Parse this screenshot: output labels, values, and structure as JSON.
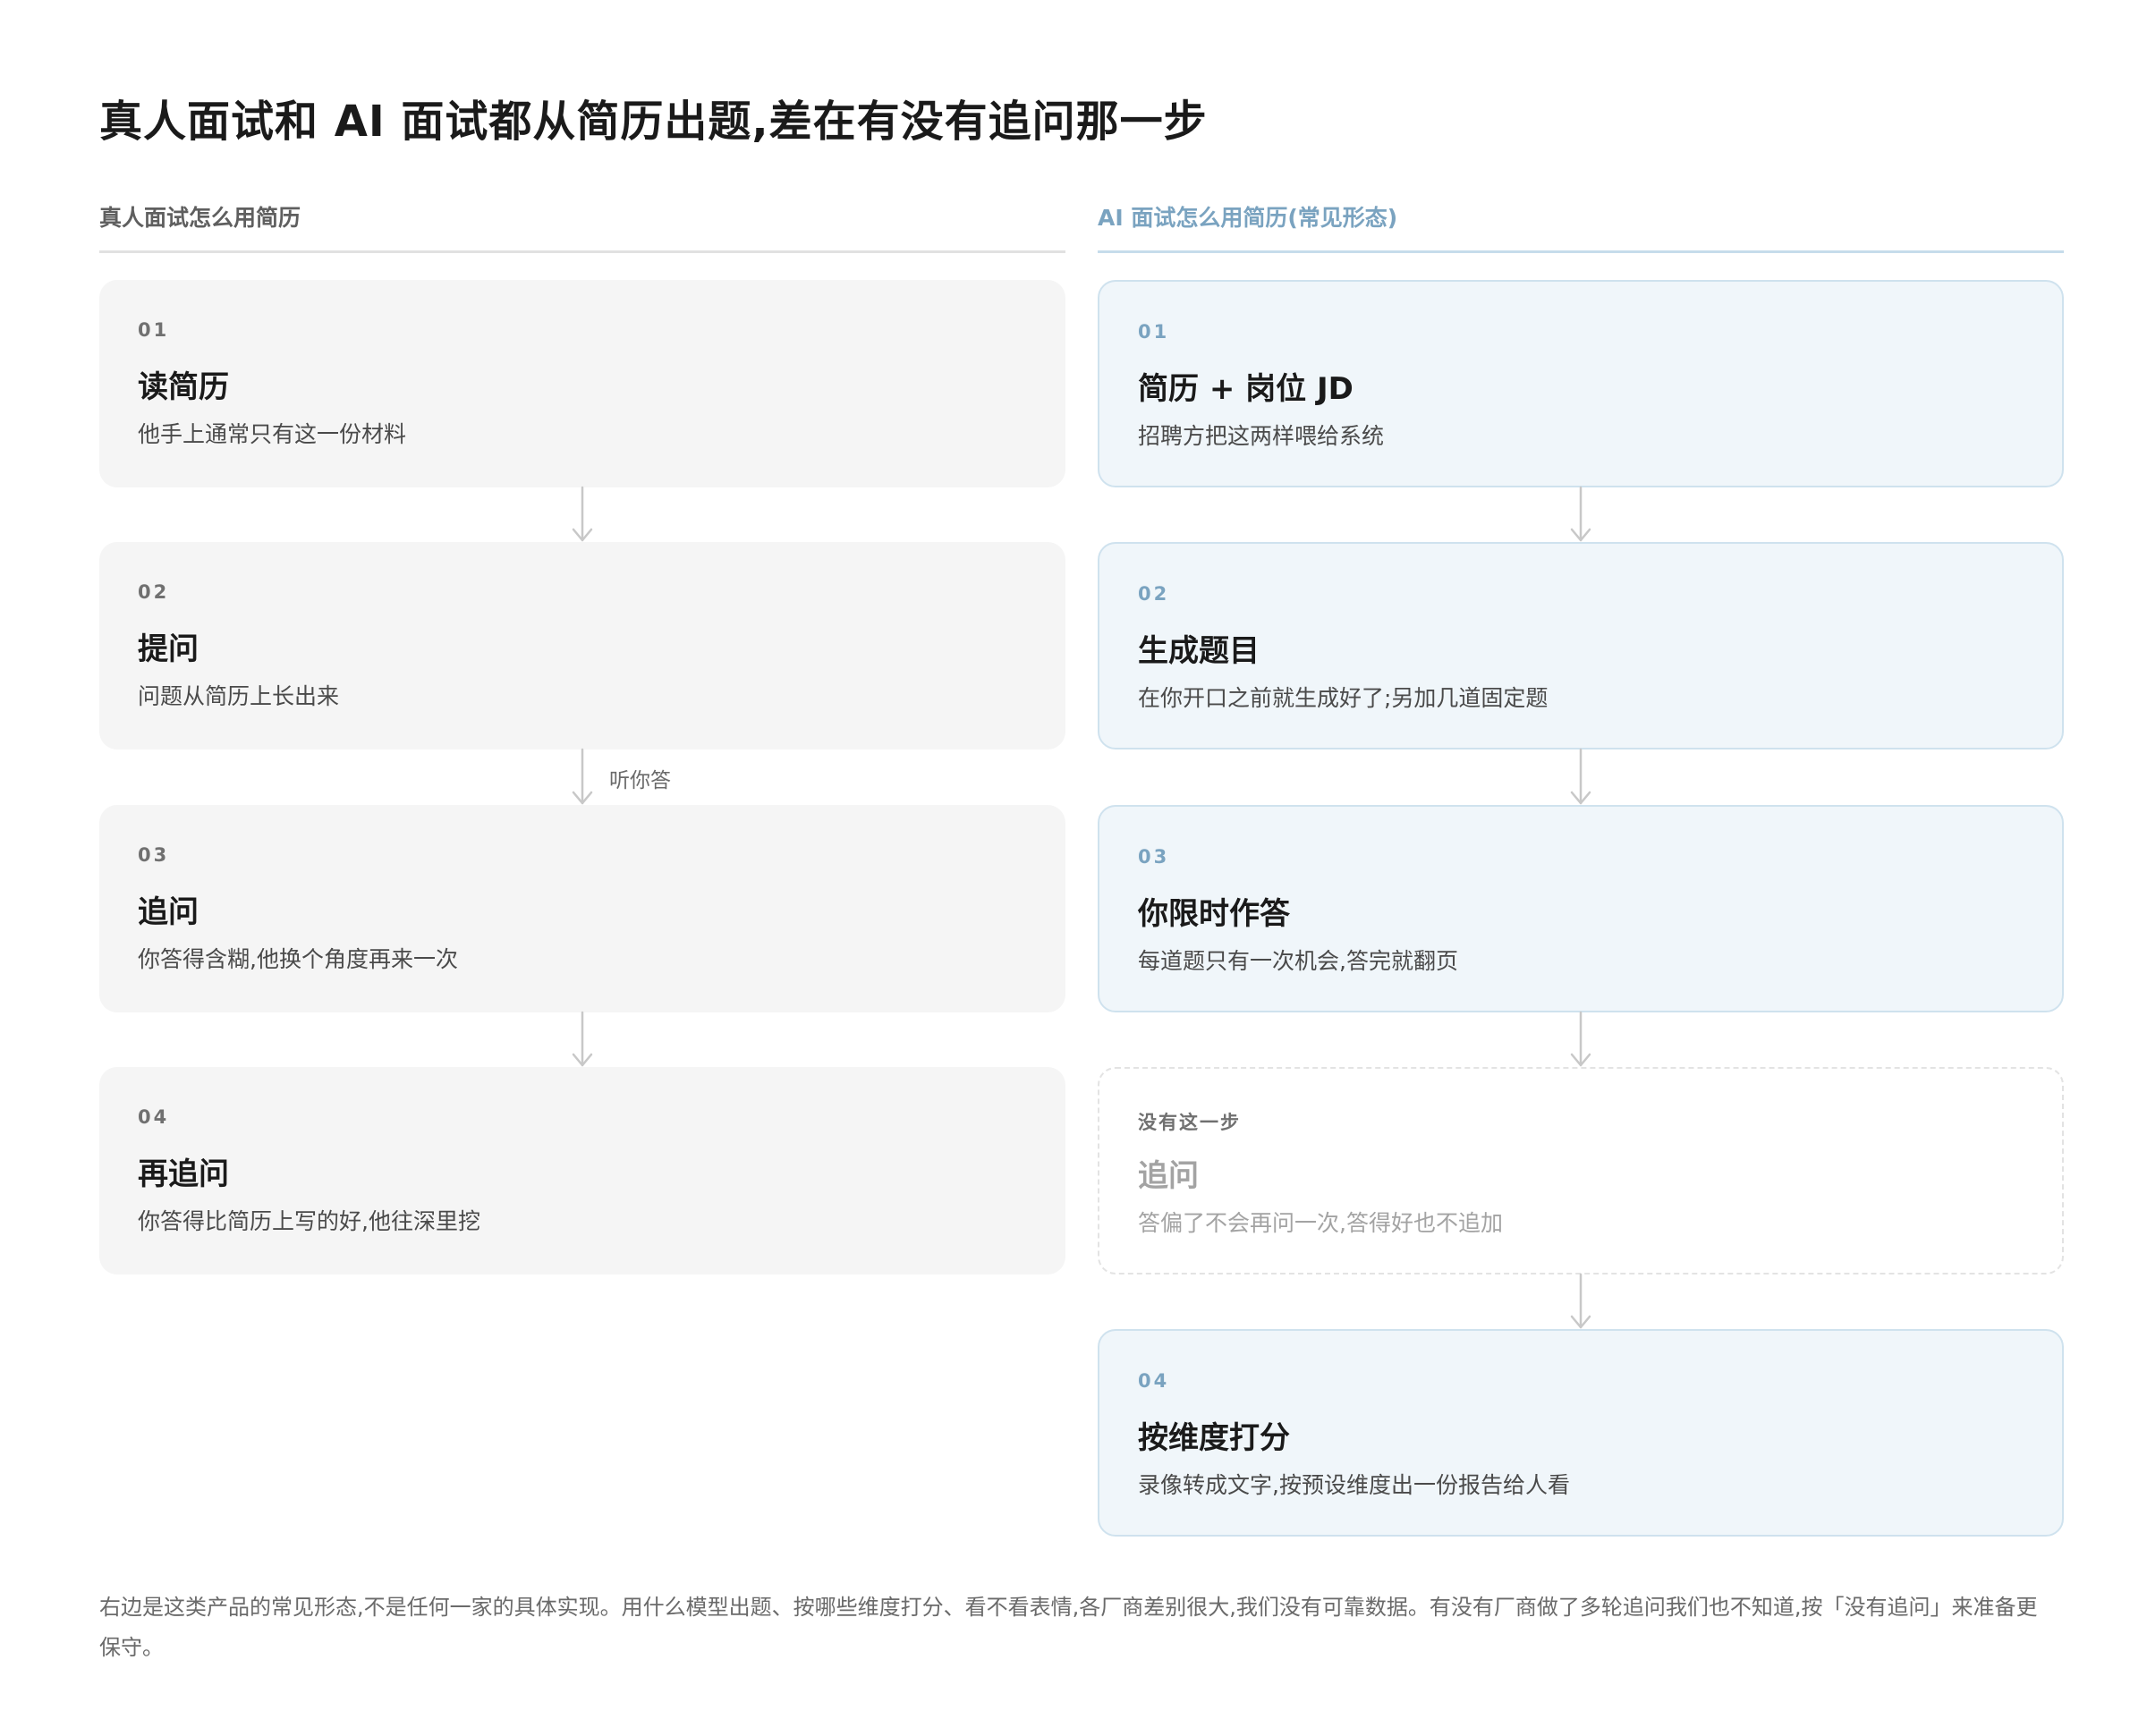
{
  "title": "真人面试和 AI 面试都从简历出题,差在有没有追问那一步",
  "human": {
    "heading": "真人面试怎么用简历",
    "arrow_label": "听你答",
    "steps": [
      {
        "num": "01",
        "title": "读简历",
        "desc": "他手上通常只有这一份材料"
      },
      {
        "num": "02",
        "title": "提问",
        "desc": "问题从简历上长出来"
      },
      {
        "num": "03",
        "title": "追问",
        "desc": "你答得含糊,他换个角度再来一次"
      },
      {
        "num": "04",
        "title": "再追问",
        "desc": "你答得比简历上写的好,他往深里挖"
      }
    ]
  },
  "ai": {
    "heading": "AI 面试怎么用简历(常见形态)",
    "steps": [
      {
        "num": "01",
        "title": "简历 + 岗位 JD",
        "desc": "招聘方把这两样喂给系统"
      },
      {
        "num": "02",
        "title": "生成题目",
        "desc": "在你开口之前就生成好了;另加几道固定题"
      },
      {
        "num": "03",
        "title": "你限时作答",
        "desc": "每道题只有一次机会,答完就翻页"
      },
      {
        "num": "没有这一步",
        "title": "追问",
        "desc": "答偏了不会再问一次,答得好也不追加"
      },
      {
        "num": "04",
        "title": "按维度打分",
        "desc": "录像转成文字,按预设维度出一份报告给人看"
      }
    ]
  },
  "footnote": "右边是这类产品的常见形态,不是任何一家的具体实现。用什么模型出题、按哪些维度打分、看不看表情,各厂商差别很大,我们没有可靠数据。有没有厂商做了多轮追问我们也不知道,按「没有追问」来准备更保守。",
  "colors": {
    "human_card": "#f5f5f5",
    "ai_card": "#f0f6fa",
    "ai_border": "#cfe2ee",
    "ai_accent": "#7aa3c0",
    "arrow": "#c8c8c8"
  }
}
